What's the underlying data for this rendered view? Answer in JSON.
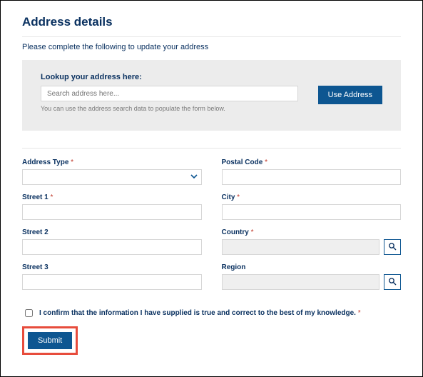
{
  "title": "Address details",
  "instruction": "Please complete the following to update your address",
  "lookup": {
    "label": "Lookup your address here:",
    "placeholder": "Search address here...",
    "hint": "You can use the address search data to populate the form below.",
    "use_button": "Use Address"
  },
  "fields": {
    "address_type": {
      "label": "Address Type",
      "required": true,
      "value": ""
    },
    "postal_code": {
      "label": "Postal Code",
      "required": true,
      "value": ""
    },
    "street1": {
      "label": "Street 1",
      "required": true,
      "value": ""
    },
    "city": {
      "label": "City",
      "required": true,
      "value": ""
    },
    "street2": {
      "label": "Street 2",
      "required": false,
      "value": ""
    },
    "country": {
      "label": "Country",
      "required": true,
      "value": ""
    },
    "street3": {
      "label": "Street 3",
      "required": false,
      "value": ""
    },
    "region": {
      "label": "Region",
      "required": false,
      "value": ""
    }
  },
  "confirm": {
    "label": "I confirm that the information I have supplied is true and correct to the best of my knowledge.",
    "required": true,
    "checked": false
  },
  "submit_label": "Submit",
  "asterisk": " *",
  "colors": {
    "brand_navy": "#0a3160",
    "brand_blue": "#0d5691",
    "panel_grey": "#ececec",
    "required_red": "#c0392b",
    "highlight_red": "#e74c3c"
  }
}
